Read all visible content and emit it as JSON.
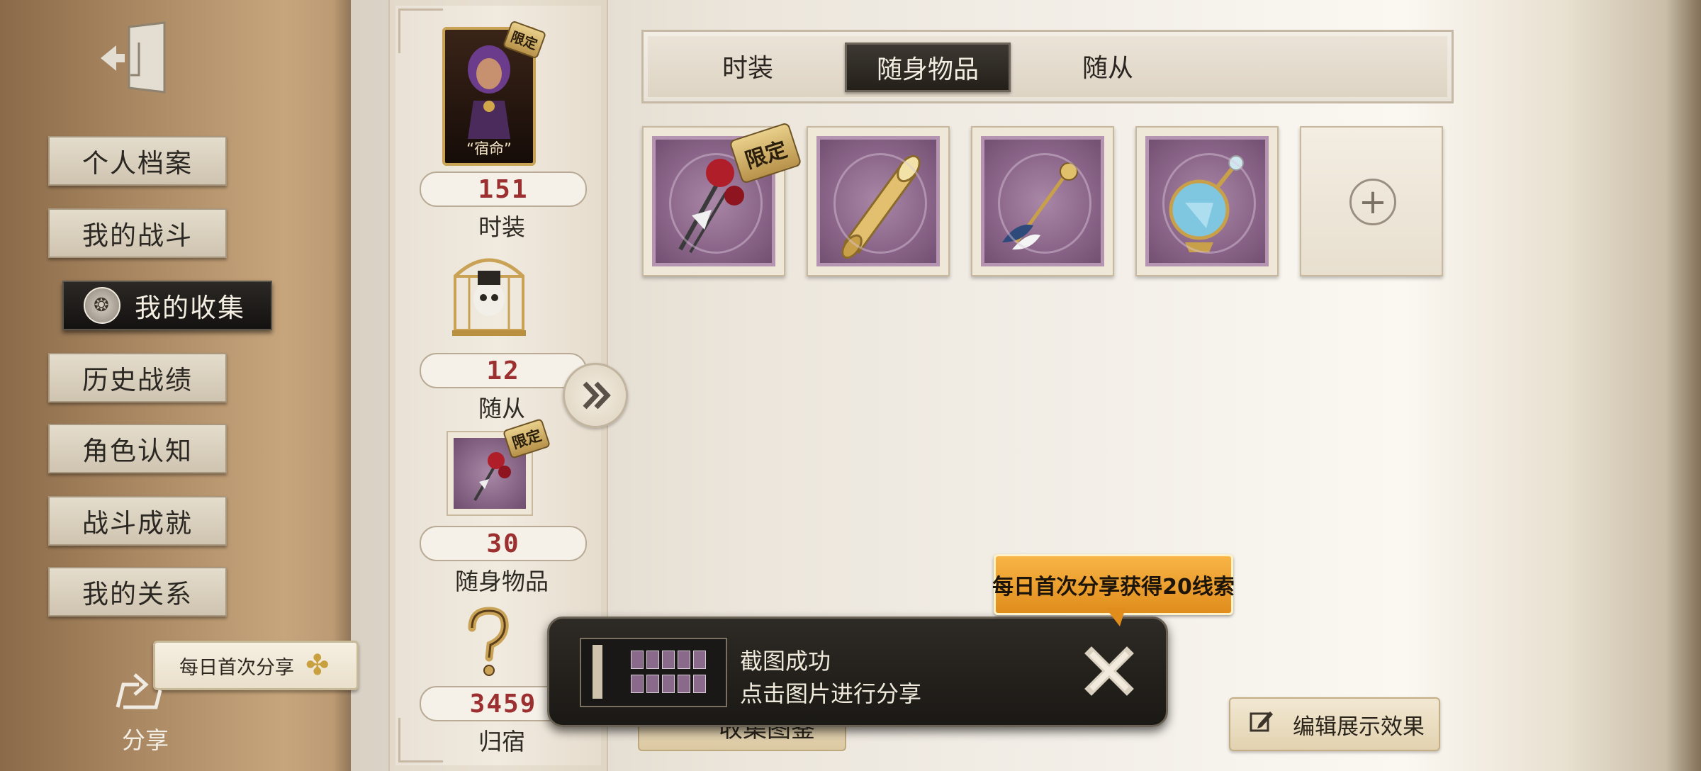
{
  "nav": {
    "items": [
      "个人档案",
      "我的战斗",
      "我的收集",
      "历史战绩",
      "角色认知",
      "战斗成就",
      "我的关系"
    ],
    "active_index": 2
  },
  "portrait": {
    "caption": "“宿命”",
    "limited_label": "限定"
  },
  "stats": [
    {
      "value": "151",
      "label": "时装"
    },
    {
      "value": "12",
      "label": "随从"
    },
    {
      "value": "30",
      "label": "随身物品"
    },
    {
      "value": "3459",
      "label": "归宿"
    }
  ],
  "stat_limited_label": "限定",
  "tabs": {
    "items": [
      "时装",
      "随身物品",
      "随从"
    ],
    "active_index": 1
  },
  "items": [
    {
      "icon": "rose-bouquet-icon",
      "limited": true,
      "limited_label": "限定"
    },
    {
      "icon": "golden-scroll-icon",
      "limited": false
    },
    {
      "icon": "feather-brooch-icon",
      "limited": false
    },
    {
      "icon": "perfume-bottle-icon",
      "limited": false
    },
    {
      "icon": "add-icon",
      "empty": true
    }
  ],
  "share": {
    "daily_label": "每日首次分享",
    "label": "分享"
  },
  "bubble": {
    "text": "每日首次分享获得20线索"
  },
  "toast": {
    "title": "截图成功",
    "subtitle": "点击图片进行分享"
  },
  "buttons": {
    "collection": "收集图鉴",
    "edit": "编辑展示效果"
  },
  "colors": {
    "accent_red": "#9c2f2f",
    "bubble_orange": "#f0a030",
    "tab_dark": "#2b2620"
  }
}
